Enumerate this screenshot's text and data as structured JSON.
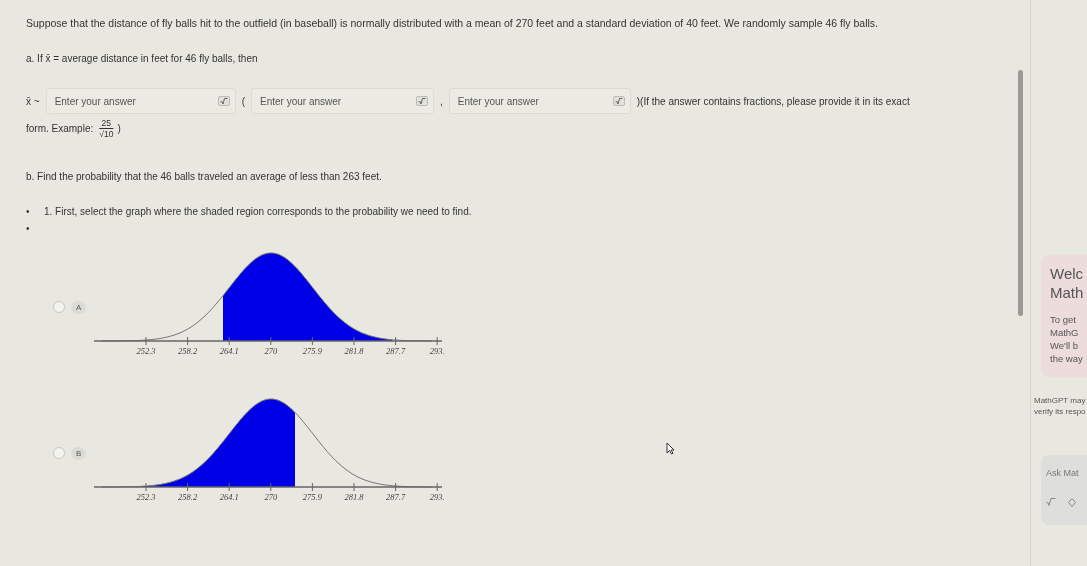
{
  "problem": {
    "intro": "Suppose that the distance of fly balls hit to the outfield (in baseball) is normally distributed with a mean of 270 feet and a standard deviation of 40 feet. We randomly sample 46 fly balls.",
    "part_a": "a. If x̄ = average distance in feet for 46 fly balls, then",
    "answer_row": {
      "lead": "x̄ ~",
      "fields": [
        {
          "placeholder": "Enter your answer",
          "after": "("
        },
        {
          "placeholder": "Enter your answer",
          "after": ","
        },
        {
          "placeholder": "Enter your answer",
          "after": ")(If the answer contains fractions, please provide it in its exact"
        }
      ]
    },
    "example": {
      "label": "form. Example:",
      "numerator": "25",
      "denominator": "√10",
      "close": ")"
    },
    "part_b": "b. Find the probability that the 46 balls traveled an average of less than 263 feet.",
    "steps": [
      {
        "bullet": "•",
        "text": "1. First, select the graph where the shaded region corresponds to the probability we need to find."
      },
      {
        "bullet": "•"
      }
    ],
    "options": [
      {
        "letter": "A",
        "selected": false,
        "kind": "right-tail",
        "ticks": [
          "252.3",
          "258.2",
          "264.1",
          "270",
          "275.9",
          "281.8",
          "287.7",
          "293."
        ]
      },
      {
        "letter": "B",
        "selected": false,
        "kind": "left-tail",
        "ticks": [
          "252.3",
          "258.2",
          "264.1",
          "270",
          "275.9",
          "281.8",
          "287.7",
          "293."
        ]
      }
    ]
  },
  "sidebar": {
    "heading": [
      "Welc",
      "Math"
    ],
    "body": [
      "To get",
      "MathG",
      "We'll b",
      "the way"
    ],
    "disclaimer": [
      "MathGPT may",
      "verify its respo"
    ],
    "ask_placeholder": "Ask Mat"
  }
}
